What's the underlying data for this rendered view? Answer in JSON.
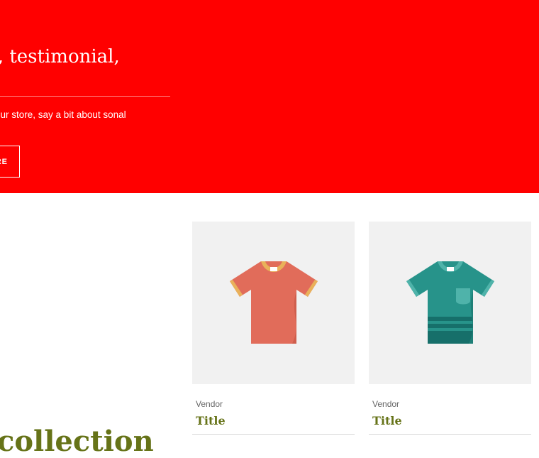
{
  "hero": {
    "title": "otion, testimonial, ntent",
    "text": "omers to your store, say a bit about sonal promotions",
    "button_label": "RE"
  },
  "collection": {
    "heading": "collection"
  },
  "products": [
    {
      "vendor": "Vendor",
      "title": "Title",
      "icon": "coral-tshirt-icon"
    },
    {
      "vendor": "Vendor",
      "title": "Title",
      "icon": "teal-tshirt-icon"
    }
  ]
}
